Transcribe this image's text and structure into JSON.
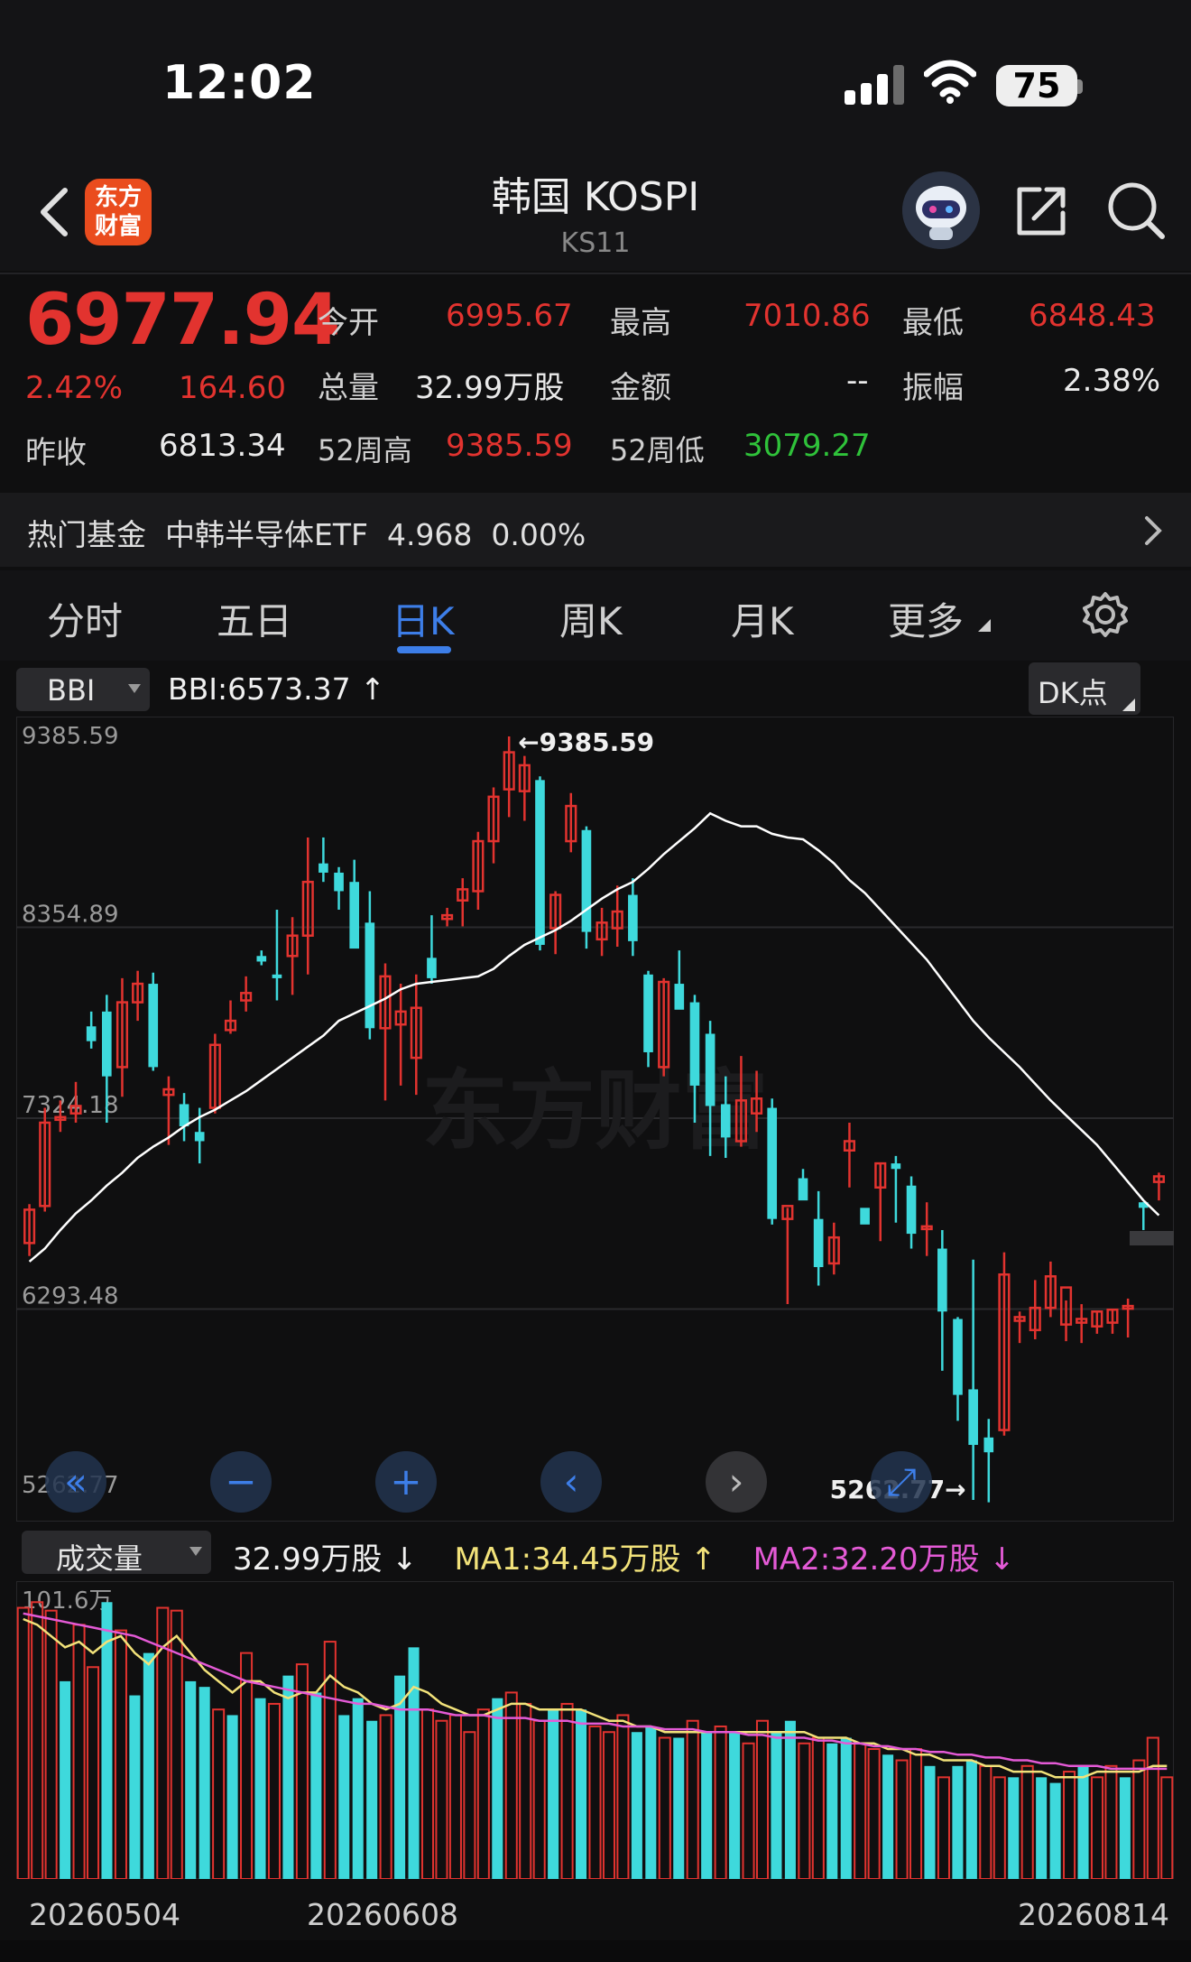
{
  "status": {
    "time": "12:02",
    "battery": "75"
  },
  "nav": {
    "title": "韩国 KOSPI",
    "subtitle": "KS11",
    "logo_line1": "东方",
    "logo_line2": "财富"
  },
  "quote": {
    "price": "6977.94",
    "change_pct": "2.42%",
    "change": "164.60",
    "open_label": "今开",
    "open": "6995.67",
    "high_label": "最高",
    "high": "7010.86",
    "low_label": "最低",
    "low": "6848.43",
    "vol_label": "总量",
    "vol": "32.99万股",
    "amount_label": "金额",
    "amount": "--",
    "amp_label": "振幅",
    "amp": "2.38%",
    "prev_label": "昨收",
    "prev": "6813.34",
    "h52_label": "52周高",
    "h52": "9385.59",
    "l52_label": "52周低",
    "l52": "3079.27"
  },
  "fund": {
    "text": "热门基金  中韩半导体ETF  4.968  0.00%"
  },
  "tabs": [
    "分时",
    "五日",
    "日K",
    "周K",
    "月K",
    "更多"
  ],
  "chart_header": {
    "indicator": "BBI",
    "bbi": "BBI:6573.37 ↑",
    "dk": "DK点"
  },
  "volume_header": {
    "indicator": "成交量",
    "vol": "32.99万股 ↓",
    "ma1": "MA1:34.45万股 ↑",
    "ma2": "MA2:32.20万股 ↓"
  },
  "colors": {
    "up": "#e2332f",
    "down": "#3ed9dc",
    "ma1": "#f2e27a",
    "ma2": "#e45ad6",
    "bbi": "#ffffff",
    "accent": "#3d7ee8"
  },
  "chart_data": [
    {
      "type": "candlestick",
      "y_ticks": [
        "9385.59",
        "8354.89",
        "7324.18",
        "6293.48",
        "5262.77"
      ],
      "ylim": [
        5262.77,
        9385.59
      ],
      "high_annotation": "←9385.59",
      "low_annotation": "5262.77→",
      "candles": [
        {
          "o": 6650,
          "h": 6860,
          "l": 6580,
          "c": 6830
        },
        {
          "o": 6850,
          "h": 7380,
          "l": 6820,
          "c": 7300
        },
        {
          "o": 7320,
          "h": 7420,
          "l": 7250,
          "c": 7330
        },
        {
          "o": 7350,
          "h": 7520,
          "l": 7300,
          "c": 7390
        },
        {
          "o": 7820,
          "h": 7900,
          "l": 7700,
          "c": 7740
        },
        {
          "o": 7900,
          "h": 7990,
          "l": 7300,
          "c": 7550
        },
        {
          "o": 7600,
          "h": 8080,
          "l": 7440,
          "c": 7950
        },
        {
          "o": 7950,
          "h": 8120,
          "l": 7850,
          "c": 8050
        },
        {
          "o": 8050,
          "h": 8110,
          "l": 7580,
          "c": 7600
        },
        {
          "o": 7450,
          "h": 7550,
          "l": 7180,
          "c": 7480
        },
        {
          "o": 7400,
          "h": 7460,
          "l": 7200,
          "c": 7280
        },
        {
          "o": 7250,
          "h": 7380,
          "l": 7080,
          "c": 7200
        },
        {
          "o": 7380,
          "h": 7780,
          "l": 7350,
          "c": 7720
        },
        {
          "o": 7800,
          "h": 7960,
          "l": 7780,
          "c": 7850
        },
        {
          "o": 7960,
          "h": 8090,
          "l": 7900,
          "c": 8000
        },
        {
          "o": 8200,
          "h": 8230,
          "l": 8150,
          "c": 8170
        },
        {
          "o": 8100,
          "h": 8450,
          "l": 7960,
          "c": 8080
        },
        {
          "o": 8200,
          "h": 8410,
          "l": 7990,
          "c": 8310
        },
        {
          "o": 8310,
          "h": 8840,
          "l": 8100,
          "c": 8600
        },
        {
          "o": 8700,
          "h": 8840,
          "l": 8600,
          "c": 8650
        },
        {
          "o": 8650,
          "h": 8680,
          "l": 8450,
          "c": 8550
        },
        {
          "o": 8600,
          "h": 8720,
          "l": 8290,
          "c": 8240
        },
        {
          "o": 8380,
          "h": 8550,
          "l": 7750,
          "c": 7810
        },
        {
          "o": 7810,
          "h": 8160,
          "l": 7420,
          "c": 8090
        },
        {
          "o": 7830,
          "h": 8050,
          "l": 7500,
          "c": 7900
        },
        {
          "o": 7650,
          "h": 8100,
          "l": 7450,
          "c": 7920
        },
        {
          "o": 8190,
          "h": 8420,
          "l": 8050,
          "c": 8080
        },
        {
          "o": 8400,
          "h": 8460,
          "l": 8360,
          "c": 8420
        },
        {
          "o": 8500,
          "h": 8620,
          "l": 8360,
          "c": 8560
        },
        {
          "o": 8550,
          "h": 8870,
          "l": 8450,
          "c": 8820
        },
        {
          "o": 8820,
          "h": 9110,
          "l": 8700,
          "c": 9060
        },
        {
          "o": 9100,
          "h": 9385.59,
          "l": 8950,
          "c": 9300
        },
        {
          "o": 9090,
          "h": 9280,
          "l": 8930,
          "c": 9230
        },
        {
          "o": 9150,
          "h": 9170,
          "l": 8230,
          "c": 8260
        },
        {
          "o": 8350,
          "h": 8550,
          "l": 8210,
          "c": 8530
        },
        {
          "o": 8820,
          "h": 9080,
          "l": 8760,
          "c": 9010
        },
        {
          "o": 8880,
          "h": 8900,
          "l": 8240,
          "c": 8330
        },
        {
          "o": 8290,
          "h": 8460,
          "l": 8200,
          "c": 8380
        },
        {
          "o": 8350,
          "h": 8580,
          "l": 8250,
          "c": 8440
        },
        {
          "o": 8530,
          "h": 8620,
          "l": 8200,
          "c": 8280
        },
        {
          "o": 8100,
          "h": 8120,
          "l": 7600,
          "c": 7680
        },
        {
          "o": 7600,
          "h": 8080,
          "l": 7550,
          "c": 8060
        },
        {
          "o": 8050,
          "h": 8230,
          "l": 7930,
          "c": 7910
        },
        {
          "o": 7950,
          "h": 7990,
          "l": 7300,
          "c": 7500
        },
        {
          "o": 7780,
          "h": 7850,
          "l": 7120,
          "c": 7390
        },
        {
          "o": 7400,
          "h": 7550,
          "l": 7110,
          "c": 7220
        },
        {
          "o": 7200,
          "h": 7660,
          "l": 7170,
          "c": 7420
        },
        {
          "o": 7350,
          "h": 7580,
          "l": 7250,
          "c": 7430
        },
        {
          "o": 7380,
          "h": 7430,
          "l": 6750,
          "c": 6780
        },
        {
          "o": 6780,
          "h": 6840,
          "l": 6320,
          "c": 6850
        },
        {
          "o": 7000,
          "h": 7050,
          "l": 6910,
          "c": 6880
        },
        {
          "o": 6780,
          "h": 6930,
          "l": 6420,
          "c": 6520
        },
        {
          "o": 6540,
          "h": 6760,
          "l": 6480,
          "c": 6680
        },
        {
          "o": 7150,
          "h": 7300,
          "l": 6950,
          "c": 7200
        },
        {
          "o": 6840,
          "h": 6820,
          "l": 6810,
          "c": 6750
        },
        {
          "o": 6950,
          "h": 7080,
          "l": 6660,
          "c": 7080
        },
        {
          "o": 7080,
          "h": 7120,
          "l": 6760,
          "c": 7050
        },
        {
          "o": 6960,
          "h": 7010,
          "l": 6620,
          "c": 6700
        },
        {
          "o": 6730,
          "h": 6870,
          "l": 6580,
          "c": 6740
        },
        {
          "o": 6620,
          "h": 6720,
          "l": 5960,
          "c": 6280
        },
        {
          "o": 6240,
          "h": 6250,
          "l": 5690,
          "c": 5830
        },
        {
          "o": 5860,
          "h": 6560,
          "l": 5262.77,
          "c": 5560
        },
        {
          "o": 5600,
          "h": 5700,
          "l": 5250,
          "c": 5520
        },
        {
          "o": 5640,
          "h": 6600,
          "l": 5610,
          "c": 6480
        },
        {
          "o": 6230,
          "h": 6280,
          "l": 6110,
          "c": 6250
        },
        {
          "o": 6180,
          "h": 6450,
          "l": 6130,
          "c": 6300
        },
        {
          "o": 6300,
          "h": 6550,
          "l": 6250,
          "c": 6470
        },
        {
          "o": 6210,
          "h": 6340,
          "l": 6120,
          "c": 6410
        },
        {
          "o": 6220,
          "h": 6320,
          "l": 6110,
          "c": 6240
        },
        {
          "o": 6200,
          "h": 6280,
          "l": 6160,
          "c": 6280
        },
        {
          "o": 6220,
          "h": 6290,
          "l": 6160,
          "c": 6290
        },
        {
          "o": 6300,
          "h": 6350,
          "l": 6140,
          "c": 6310
        },
        {
          "o": 6870,
          "h": 6870,
          "l": 6720,
          "c": 6840
        },
        {
          "o": 6980,
          "h": 7030,
          "l": 6880,
          "c": 7010
        }
      ],
      "bbi": [
        6550,
        6620,
        6720,
        6810,
        6880,
        6960,
        7030,
        7110,
        7170,
        7220,
        7280,
        7330,
        7370,
        7420,
        7470,
        7530,
        7590,
        7650,
        7710,
        7770,
        7850,
        7890,
        7930,
        7970,
        8020,
        8050,
        8060,
        8070,
        8080,
        8090,
        8130,
        8200,
        8260,
        8300,
        8340,
        8390,
        8450,
        8510,
        8560,
        8600,
        8670,
        8750,
        8820,
        8890,
        8970,
        8930,
        8900,
        8900,
        8860,
        8840,
        8830,
        8770,
        8700,
        8610,
        8540,
        8450,
        8360,
        8270,
        8180,
        8070,
        7960,
        7850,
        7760,
        7680,
        7600,
        7510,
        7420,
        7340,
        7260,
        7180,
        7080,
        6980,
        6880,
        6800
      ],
      "bbi_note": "approximate BBI curve, one value per candle (sampled)"
    },
    {
      "type": "bar",
      "ylabel_top": "101.6万",
      "ylim": [
        0,
        101.6
      ],
      "dates": [
        "20260504",
        "20260608",
        "20260814"
      ],
      "values": [
        96,
        98,
        95,
        70,
        90,
        75,
        98,
        88,
        65,
        80,
        96,
        95,
        70,
        68,
        60,
        58,
        80,
        64,
        62,
        72,
        76,
        66,
        84,
        58,
        64,
        56,
        58,
        72,
        82,
        60,
        56,
        58,
        52,
        60,
        64,
        66,
        62,
        56,
        60,
        62,
        60,
        54,
        52,
        58,
        52,
        54,
        50,
        50,
        56,
        52,
        54,
        52,
        48,
        56,
        52,
        56,
        48,
        50,
        48,
        50,
        48,
        46,
        44,
        42,
        46,
        40,
        36,
        40,
        42,
        40,
        36,
        36,
        40,
        36,
        34,
        38,
        40,
        36,
        40,
        36,
        42,
        50,
        36
      ],
      "up_flags": [
        1,
        1,
        1,
        0,
        1,
        1,
        0,
        1,
        0,
        0,
        1,
        1,
        0,
        0,
        1,
        0,
        1,
        0,
        1,
        0,
        1,
        0,
        1,
        0,
        0,
        0,
        1,
        0,
        0,
        1,
        1,
        1,
        1,
        1,
        0,
        1,
        1,
        1,
        0,
        1,
        0,
        1,
        1,
        1,
        0,
        0,
        1,
        0,
        1,
        0,
        1,
        0,
        1,
        1,
        0,
        0,
        1,
        1,
        0,
        0,
        1,
        1,
        0,
        1,
        1,
        0,
        1,
        0,
        0,
        1,
        1,
        0,
        1,
        0,
        0,
        1,
        0,
        1,
        1,
        0,
        1,
        1,
        1
      ],
      "ma1": [
        92,
        90,
        86,
        82,
        84,
        80,
        84,
        86,
        80,
        76,
        82,
        86,
        80,
        74,
        70,
        66,
        70,
        70,
        66,
        64,
        66,
        66,
        72,
        68,
        66,
        62,
        60,
        62,
        68,
        66,
        62,
        60,
        58,
        58,
        60,
        62,
        62,
        60,
        60,
        60,
        60,
        58,
        56,
        56,
        54,
        54,
        52,
        52,
        52,
        52,
        52,
        52,
        52,
        52,
        52,
        52,
        52,
        50,
        50,
        50,
        48,
        48,
        46,
        46,
        44,
        44,
        42,
        42,
        42,
        40,
        40,
        38,
        38,
        38,
        36,
        36,
        36,
        38,
        38,
        38,
        38,
        40,
        40
      ],
      "ma2": [
        94,
        93,
        92,
        91,
        90,
        89,
        88,
        87,
        86,
        84,
        82,
        80,
        78,
        76,
        74,
        72,
        70,
        69,
        68,
        67,
        66,
        65,
        64,
        63,
        62,
        62,
        61,
        60,
        60,
        60,
        59,
        58,
        58,
        58,
        57,
        57,
        57,
        56,
        56,
        56,
        55,
        55,
        55,
        54,
        54,
        54,
        53,
        53,
        53,
        52,
        52,
        52,
        51,
        51,
        50,
        50,
        50,
        49,
        49,
        48,
        48,
        47,
        47,
        46,
        46,
        45,
        45,
        44,
        44,
        43,
        43,
        42,
        42,
        41,
        41,
        40,
        40,
        40,
        39,
        39,
        39,
        39,
        39
      ]
    }
  ],
  "watermark": "东方财富",
  "controls": [
    "快退",
    "缩小",
    "放大",
    "左移",
    "右移",
    "全屏"
  ]
}
